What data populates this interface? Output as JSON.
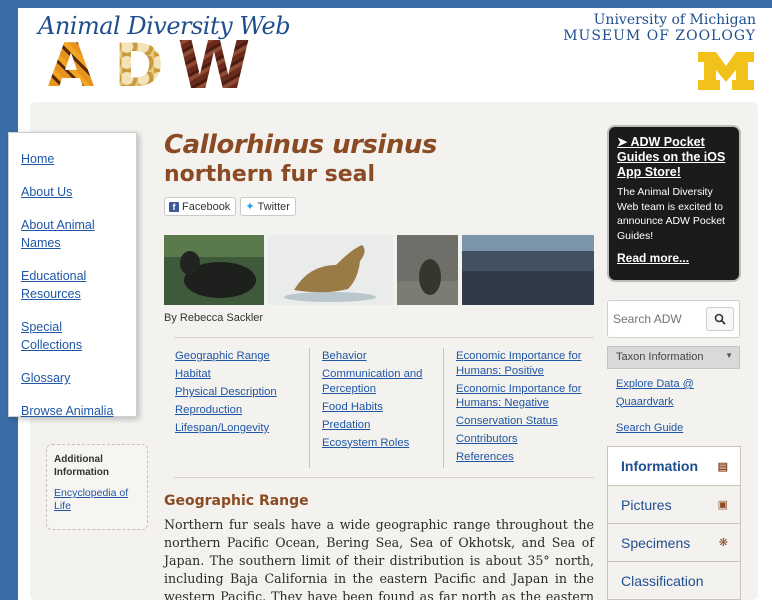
{
  "header": {
    "site_title": "Animal Diversity Web",
    "logo_letters": [
      "A",
      "D",
      "W"
    ],
    "univ_line1": "University of Michigan",
    "univ_line2": "MUSEUM OF ZOOLOGY"
  },
  "nav": {
    "items": [
      {
        "label": "Home"
      },
      {
        "label": "About Us"
      },
      {
        "label": "About Animal Names"
      },
      {
        "label": "Educational Resources"
      },
      {
        "label": "Special Collections"
      },
      {
        "label": "Glossary"
      },
      {
        "label": "Browse Animalia"
      }
    ]
  },
  "additional_info": {
    "title": "Additional Information",
    "link": "Encyclopedia of Life"
  },
  "species": {
    "scientific_name": "Callorhinus ursinus",
    "common_name": "northern fur seal",
    "byline": "By Rebecca Sackler"
  },
  "share": {
    "facebook": "Facebook",
    "twitter": "Twitter"
  },
  "toc": {
    "col1": [
      "Geographic Range",
      "Habitat",
      "Physical Description",
      "Reproduction",
      "Lifespan/Longevity"
    ],
    "col2": [
      "Behavior",
      "Communication and Perception",
      "Food Habits",
      "Predation",
      "Ecosystem Roles"
    ],
    "col3": [
      "Economic Importance for Humans: Positive",
      "Economic Importance for Humans: Negative",
      "Conservation Status",
      "Contributors",
      "References"
    ]
  },
  "section": {
    "heading": "Geographic Range",
    "text": "Northern fur seals have a wide geographic range throughout the northern Pacific Ocean, Bering Sea, Sea of Okhotsk, and Sea of Japan. The southern limit of their distribution is about 35° north, including Baja California in the eastern Pacific and Japan in the western Pacific. They have been found as far north as the eastern Beaufort Sea in the Arctic, however they are more typically found"
  },
  "promo": {
    "title": "ADW Pocket Guides on the iOS App Store!",
    "body": "The Animal Diversity Web team is excited to announce ADW Pocket Guides!",
    "more": "Read more..."
  },
  "search": {
    "placeholder": "Search ADW"
  },
  "taxon": {
    "selected": "Taxon Information"
  },
  "side_links": {
    "explore": "Explore Data @ Quaardvark",
    "guide": "Search Guide"
  },
  "tabs": [
    {
      "label": "Information",
      "icon": "document-icon",
      "active": true
    },
    {
      "label": "Pictures",
      "icon": "camera-icon",
      "active": false
    },
    {
      "label": "Specimens",
      "icon": "specimen-icon",
      "active": false
    },
    {
      "label": "Classification",
      "icon": "tree-icon",
      "active": false
    }
  ],
  "colors": {
    "background": "#3b6ea8",
    "heading_brown": "#8a4b24",
    "link_blue": "#1f57a6",
    "umich_blue": "#1f4e8f",
    "umich_maize": "#f2c21a",
    "promo_bg": "#1b1b1b"
  }
}
